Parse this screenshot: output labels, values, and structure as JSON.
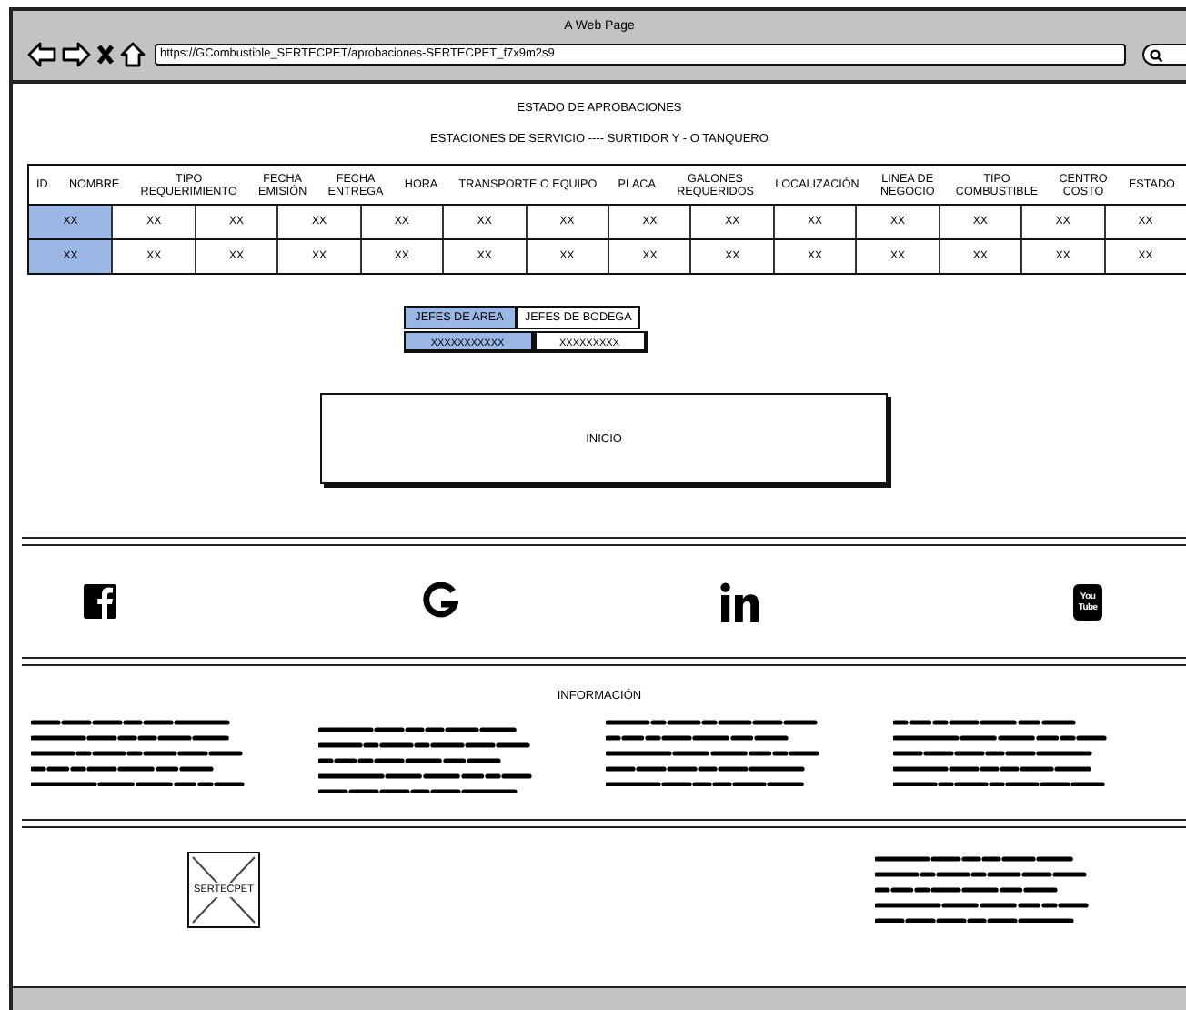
{
  "browser": {
    "title": "A Web Page",
    "url": "https://GCombustible_SERTECPET/aprobaciones-SERTECPET_f7x9m2s9"
  },
  "headings": [
    "ESTADO DE APROBACIONES",
    "ESTACIONES DE SERVICIO ---- SURTIDOR Y - O TANQUERO"
  ],
  "table": {
    "columns": [
      "ID",
      "NOMBRE",
      "TIPO\nREQUERIMIENTO",
      "FECHA\nEMISIÓN",
      "FECHA\nENTREGA",
      "HORA",
      "TRANSPORTE O EQUIPO",
      "PLACA",
      "GALONES\nREQUERIDOS",
      "LOCALIZACIÓN",
      "LINEA DE\nNEGOCIO",
      "TIPO\nCOMBUSTIBLE",
      "CENTRO\nCOSTO",
      "ESTADO"
    ],
    "rows": [
      {
        "cells": [
          {
            "text": "XX",
            "selected": true
          },
          {
            "text": "XX",
            "selected": false
          },
          {
            "text": "XX",
            "selected": false
          },
          {
            "text": "XX",
            "selected": false
          },
          {
            "text": "XX",
            "selected": false
          },
          {
            "text": "XX",
            "selected": false
          },
          {
            "text": "XX",
            "selected": false
          },
          {
            "text": "XX",
            "selected": false
          },
          {
            "text": "XX",
            "selected": false
          },
          {
            "text": "XX",
            "selected": false
          },
          {
            "text": "XX",
            "selected": false
          },
          {
            "text": "XX",
            "selected": false
          },
          {
            "text": "XX",
            "selected": false
          },
          {
            "text": "XX",
            "selected": false
          }
        ]
      },
      {
        "cells": [
          {
            "text": "XX",
            "selected": true
          },
          {
            "text": "XX",
            "selected": false
          },
          {
            "text": "XX",
            "selected": false
          },
          {
            "text": "XX",
            "selected": false
          },
          {
            "text": "XX",
            "selected": false
          },
          {
            "text": "XX",
            "selected": false
          },
          {
            "text": "XX",
            "selected": false
          },
          {
            "text": "XX",
            "selected": false
          },
          {
            "text": "XX",
            "selected": false
          },
          {
            "text": "XX",
            "selected": false
          },
          {
            "text": "XX",
            "selected": false
          },
          {
            "text": "XX",
            "selected": false
          },
          {
            "text": "XX",
            "selected": false
          },
          {
            "text": "XX",
            "selected": false
          }
        ]
      }
    ]
  },
  "tabs": [
    {
      "label": "JEFES DE AREA",
      "selected": true
    },
    {
      "label": "JEFES DE BODEGA",
      "selected": false
    }
  ],
  "tab_values": [
    {
      "text": "XXXXXXXXXXX",
      "selected": true
    },
    {
      "text": "XXXXXXXXX",
      "selected": false
    }
  ],
  "start_button": {
    "label": "INICIO"
  },
  "social_links": [
    {
      "kind": "facebook"
    },
    {
      "kind": "google"
    },
    {
      "kind": "linkedin"
    },
    {
      "kind": "youtube",
      "text": [
        "You",
        "Tube"
      ]
    }
  ],
  "info": {
    "title": "INFORMACIÓN"
  },
  "footer": {
    "logo_label": "SERTECPET"
  }
}
